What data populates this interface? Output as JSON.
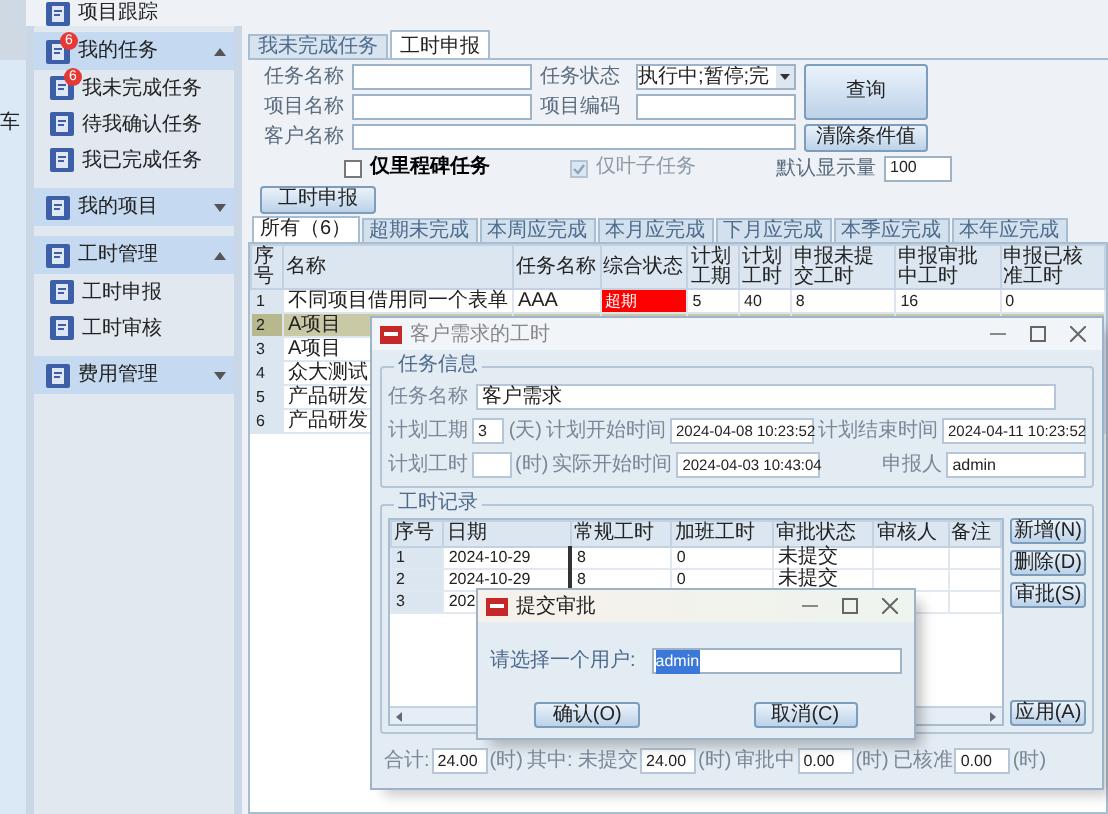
{
  "app_strip": {
    "label": "车"
  },
  "header": {
    "title": "项目跟踪"
  },
  "sidebar": {
    "groups": [
      {
        "label": "我的任务",
        "badge": "6",
        "expanded": true,
        "items": [
          {
            "label": "我未完成任务",
            "badge": "6"
          },
          {
            "label": "待我确认任务"
          },
          {
            "label": "我已完成任务"
          }
        ]
      },
      {
        "label": "我的项目",
        "expanded": false
      },
      {
        "label": "工时管理",
        "expanded": true,
        "items": [
          {
            "label": "工时申报"
          },
          {
            "label": "工时审核"
          }
        ]
      },
      {
        "label": "费用管理",
        "expanded": false
      }
    ]
  },
  "tabs": [
    {
      "label": "我未完成任务",
      "selected": false
    },
    {
      "label": "工时申报",
      "selected": true
    }
  ],
  "filters": {
    "task_name": {
      "label": "任务名称"
    },
    "status": {
      "label": "任务状态",
      "value": "执行中;暂停;完"
    },
    "project_name": {
      "label": "项目名称"
    },
    "project_code": {
      "label": "项目编码"
    },
    "customer_name": {
      "label": "客户名称"
    },
    "query_button": "查询",
    "clear_button": "清除条件值",
    "milestone_only": {
      "label": "仅里程碑任务",
      "checked": false,
      "disabled": false
    },
    "leaf_only": {
      "label": "仅叶子任务",
      "checked": true,
      "disabled": true
    },
    "default_count": {
      "label": "默认显示量",
      "value": "100"
    }
  },
  "report_button": "工时申报",
  "filter_tabs": [
    {
      "label": "所有（6）",
      "selected": true
    },
    {
      "label": "超期未完成",
      "selected": false
    },
    {
      "label": "本周应完成",
      "selected": false
    },
    {
      "label": "本月应完成",
      "selected": false
    },
    {
      "label": "下月应完成",
      "selected": false
    },
    {
      "label": "本季应完成",
      "selected": false
    },
    {
      "label": "本年应完成",
      "selected": false
    }
  ],
  "table": {
    "columns": [
      "序号",
      "名称",
      "任务名称",
      "综合状态",
      "计划工期",
      "计划工时",
      "申报未提交工时",
      "申报审批中工时",
      "申报已核准工时"
    ],
    "rows": [
      {
        "cells": [
          "1",
          "不同项目借用同一个表单",
          "AAA",
          "超期",
          "5",
          "40",
          "8",
          "16",
          "0"
        ],
        "status_alert": true,
        "selected": false
      },
      {
        "cells": [
          "2",
          "A项目"
        ],
        "selected": true
      },
      {
        "cells": [
          "3",
          "A项目"
        ],
        "selected": false
      },
      {
        "cells": [
          "4",
          "众大测试"
        ],
        "selected": false
      },
      {
        "cells": [
          "5",
          "产品研发"
        ],
        "selected": false
      },
      {
        "cells": [
          "6",
          "产品研发"
        ],
        "selected": false
      }
    ]
  },
  "hours_dialog": {
    "title": "客户需求的工时",
    "info": {
      "legend": "任务信息",
      "task_name": {
        "label": "任务名称",
        "value": "客户需求"
      },
      "plan_days": {
        "label": "计划工期",
        "value": "3",
        "unit": "(天)"
      },
      "plan_start": {
        "label": "计划开始时间",
        "value": "2024-04-08 10:23:52"
      },
      "plan_end": {
        "label": "计划结束时间",
        "value": "2024-04-11 10:23:52"
      },
      "plan_hours": {
        "label": "计划工时",
        "unit": "(时)"
      },
      "actual_start": {
        "label": "实际开始时间",
        "value": "2024-04-03 10:43:04"
      },
      "reporter": {
        "label": "申报人",
        "value": "admin"
      }
    },
    "records": {
      "legend": "工时记录",
      "columns": [
        "序号",
        "日期",
        "常规工时",
        "加班工时",
        "审批状态",
        "审核人",
        "备注"
      ],
      "rows": [
        {
          "cells": [
            "1",
            "2024-10-29",
            "8",
            "0",
            "未提交"
          ]
        },
        {
          "cells": [
            "2",
            "2024-10-29",
            "8",
            "0",
            "未提交"
          ]
        },
        {
          "cells": [
            "3",
            "202"
          ]
        }
      ],
      "buttons": [
        "新增(N)",
        "删除(D)",
        "审批(S)"
      ],
      "apply_button": "应用(A)"
    },
    "totals": [
      {
        "label": "合计:",
        "value": "24.00",
        "unit": "(时)"
      },
      {
        "label": "其中: 未提交",
        "value": "24.00",
        "unit": "(时)"
      },
      {
        "label": "审批中",
        "value": "0.00",
        "unit": "(时)"
      },
      {
        "label": "已核准",
        "value": "0.00",
        "unit": "(时)"
      }
    ]
  },
  "submit_dialog": {
    "title": "提交审批",
    "label": "请选择一个用户:",
    "value": "admin",
    "buttons": [
      "确认(O)",
      "取消(C)"
    ]
  }
}
